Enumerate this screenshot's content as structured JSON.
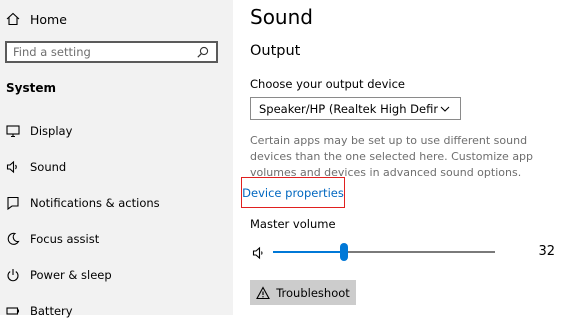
{
  "sidebar": {
    "home_label": "Home",
    "search_placeholder": "Find a setting",
    "section_title": "System",
    "items": [
      {
        "label": "Display",
        "icon": "monitor-icon"
      },
      {
        "label": "Sound",
        "icon": "speaker-icon"
      },
      {
        "label": "Notifications & actions",
        "icon": "notifications-icon"
      },
      {
        "label": "Focus assist",
        "icon": "moon-icon"
      },
      {
        "label": "Power & sleep",
        "icon": "power-icon"
      },
      {
        "label": "Battery",
        "icon": "battery-icon"
      }
    ]
  },
  "main": {
    "title": "Sound",
    "output_heading": "Output",
    "choose_device_label": "Choose your output device",
    "selected_device": "Speaker/HP (Realtek High Definiti...",
    "info_text": "Certain apps may be set up to use different sound devices than the one selected here. Customize app volumes and devices in advanced sound options.",
    "device_properties_link": "Device properties",
    "master_volume_label": "Master volume",
    "volume_value": "32",
    "troubleshoot_label": "Troubleshoot"
  },
  "colors": {
    "accent": "#0078d7",
    "link": "#0067c0",
    "highlight_border": "#e0201f",
    "sidebar_bg": "#f2f2f2"
  }
}
